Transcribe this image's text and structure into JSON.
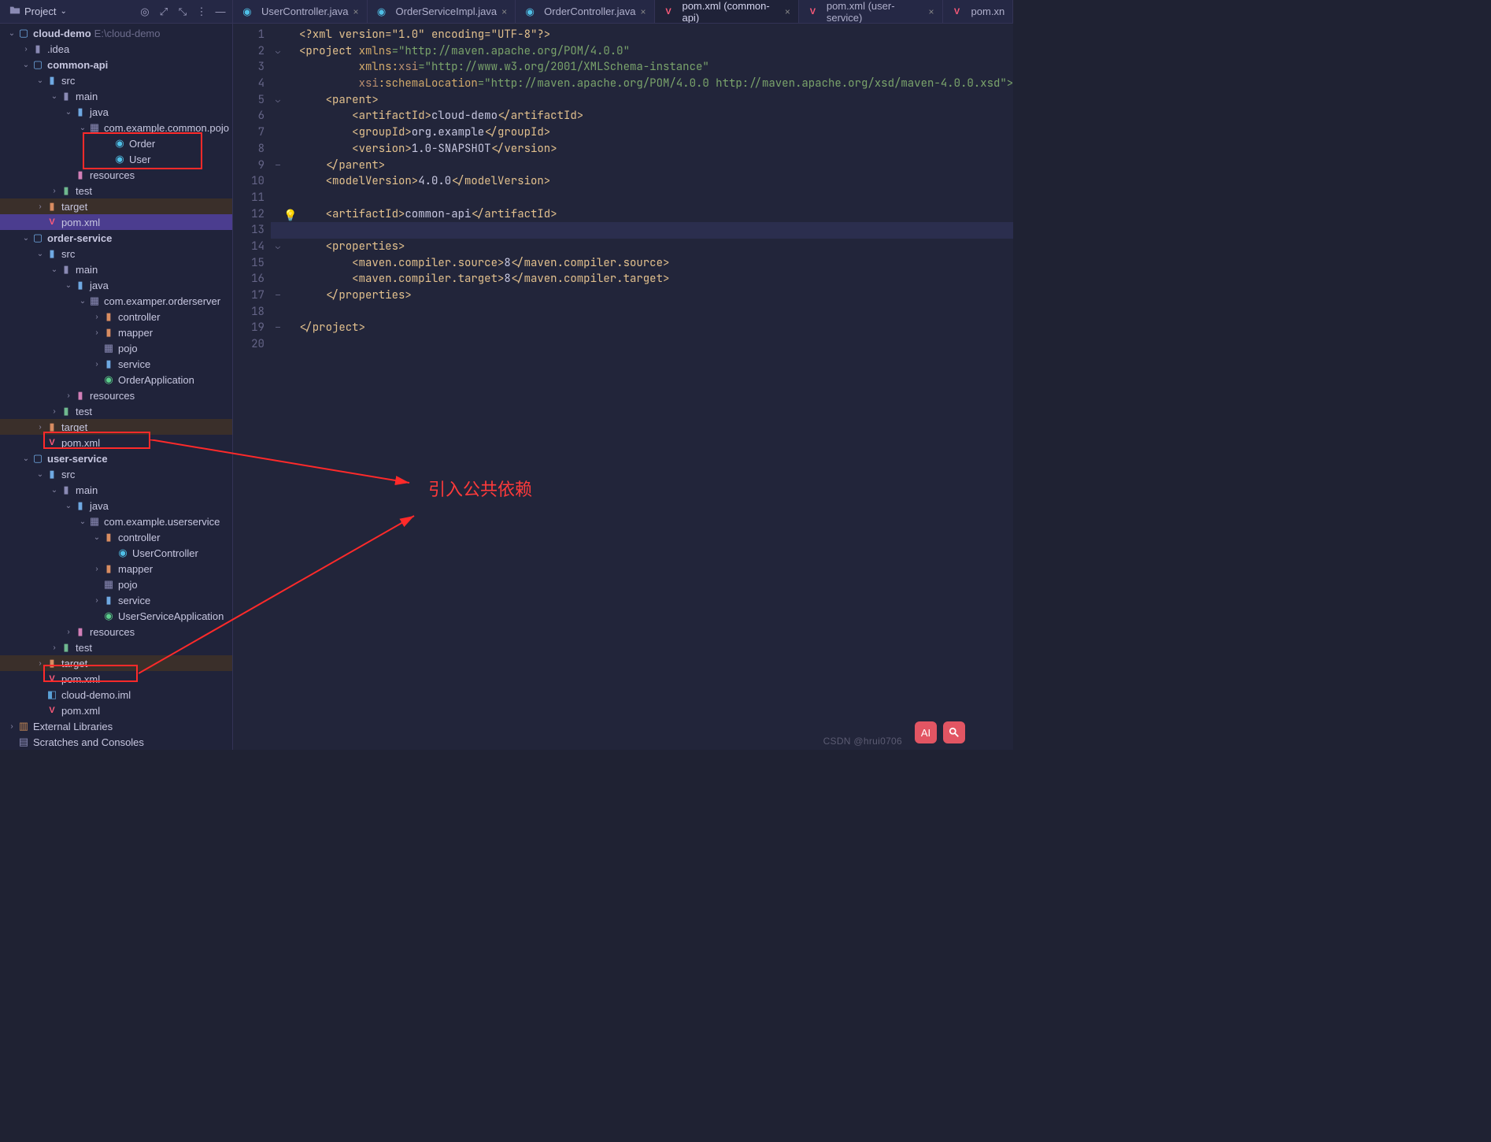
{
  "sidebar": {
    "header": {
      "label": "Project"
    },
    "root": {
      "name": "cloud-demo",
      "path": "E:\\cloud-demo"
    },
    "idea": ".idea",
    "common_api": "common-api",
    "src": "src",
    "main": "main",
    "java": "java",
    "pkg_common": "com.example.common.pojo",
    "order_class": "Order",
    "user_class": "User",
    "resources": "resources",
    "test": "test",
    "target": "target",
    "pom": "pom.xml",
    "order_service": "order-service",
    "pkg_order": "com.examper.orderserver",
    "controller": "controller",
    "mapper": "mapper",
    "pojo": "pojo",
    "service": "service",
    "order_app": "OrderApplication",
    "user_service": "user-service",
    "pkg_user": "com.example.userservice",
    "user_controller": "UserController",
    "user_app": "UserServiceApplication",
    "cloud_iml": "cloud-demo.iml",
    "ext_lib": "External Libraries",
    "scratches": "Scratches and Consoles"
  },
  "tabs": [
    {
      "label": "UserController.java",
      "icon": "class"
    },
    {
      "label": "OrderServiceImpl.java",
      "icon": "class"
    },
    {
      "label": "OrderController.java",
      "icon": "class"
    },
    {
      "label": "pom.xml (common-api)",
      "icon": "xml",
      "active": true
    },
    {
      "label": "pom.xml (user-service)",
      "icon": "xml"
    },
    {
      "label": "pom.xn",
      "icon": "xml"
    }
  ],
  "code": {
    "l1": "<?xml version=\"1.0\" encoding=\"UTF-8\"?>",
    "l2a": "<project ",
    "l2b": "xmlns",
    "l2c": "=\"http://maven.apache.org/POM/4.0.0\"",
    "l3a": "xmlns:",
    "l3b": "xsi",
    "l3c": "=\"http://www.w3.org/2001/XMLSchema-instance\"",
    "l4a": "xsi",
    "l4b": ":schemaLocation",
    "l4c": "=\"http://maven.apache.org/POM/4.0.0 http://maven.apache.org/xsd/maven-4.0.0.xsd\">",
    "parent_o": "<parent>",
    "artifact_o": "<artifactId>",
    "artifact_c": "</artifactId>",
    "artifact_v": "cloud-demo",
    "group_o": "<groupId>",
    "group_c": "</groupId>",
    "group_v": "org.example",
    "version_o": "<version>",
    "version_c": "</version>",
    "version_v": "1.0-SNAPSHOT",
    "parent_c": "</parent>",
    "mv_o": "<modelVersion>",
    "mv_c": "</modelVersion>",
    "mv_v": "4.0.0",
    "art2_v": "common-api",
    "props_o": "<properties>",
    "mcs_o": "<maven.compiler.source>",
    "mcs_c": "</maven.compiler.source>",
    "mcs_v": "8",
    "mct_o": "<maven.compiler.target>",
    "mct_c": "</maven.compiler.target>",
    "mct_v": "8",
    "props_c": "</properties>",
    "project_c": "</project>"
  },
  "annotation": "引入公共依赖",
  "watermark": "CSDN @hrui0706"
}
